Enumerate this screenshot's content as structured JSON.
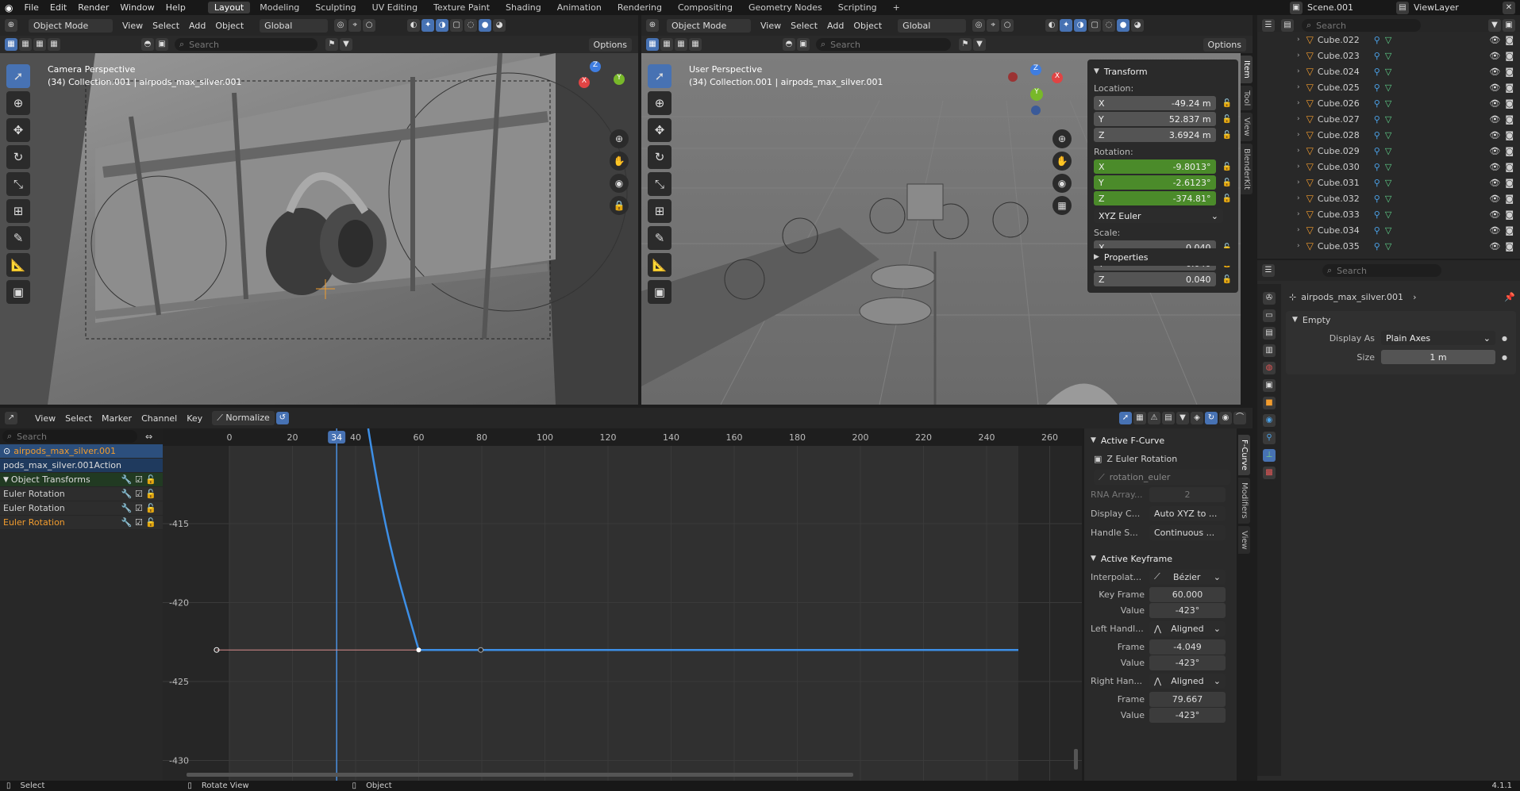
{
  "topbar": {
    "menus": [
      "File",
      "Edit",
      "Render",
      "Window",
      "Help"
    ],
    "workspaces": [
      "Layout",
      "Modeling",
      "Sculpting",
      "UV Editing",
      "Texture Paint",
      "Shading",
      "Animation",
      "Rendering",
      "Compositing",
      "Geometry Nodes",
      "Scripting"
    ],
    "active_workspace": "Layout",
    "plus": "+",
    "scene": "Scene.001",
    "view_layer": "ViewLayer"
  },
  "vp_left": {
    "mode": "Object Mode",
    "menus": [
      "View",
      "Select",
      "Add",
      "Object"
    ],
    "orientation": "Global",
    "search_placeholder": "Search",
    "options": "Options",
    "title": "Camera Perspective",
    "subtitle": "(34) Collection.001 | airpods_max_silver.001"
  },
  "vp_right": {
    "mode": "Object Mode",
    "menus": [
      "View",
      "Select",
      "Add",
      "Object"
    ],
    "orientation": "Global",
    "search_placeholder": "Search",
    "options": "Options",
    "title": "User Perspective",
    "subtitle": "(34) Collection.001 | airpods_max_silver.001",
    "gizmo": {
      "z": "Z",
      "y": "Y",
      "x": "X"
    }
  },
  "npanel": {
    "tabs": [
      "Item",
      "Tool",
      "View",
      "BlenderKit"
    ],
    "transform": "Transform",
    "location_label": "Location:",
    "location": [
      {
        "axis": "X",
        "value": "-49.24 m"
      },
      {
        "axis": "Y",
        "value": "52.837 m"
      },
      {
        "axis": "Z",
        "value": "3.6924 m"
      }
    ],
    "rotation_label": "Rotation:",
    "rotation": [
      {
        "axis": "X",
        "value": "-9.8013°"
      },
      {
        "axis": "Y",
        "value": "-2.6123°"
      },
      {
        "axis": "Z",
        "value": "-374.81°"
      }
    ],
    "rotation_mode": "XYZ Euler",
    "scale_label": "Scale:",
    "scale": [
      {
        "axis": "X",
        "value": "0.040"
      },
      {
        "axis": "Y",
        "value": "0.040"
      },
      {
        "axis": "Z",
        "value": "0.040"
      }
    ],
    "properties": "Properties"
  },
  "outliner": {
    "search_placeholder": "Search",
    "items": [
      "Cube.022",
      "Cube.023",
      "Cube.024",
      "Cube.025",
      "Cube.026",
      "Cube.027",
      "Cube.028",
      "Cube.029",
      "Cube.030",
      "Cube.031",
      "Cube.032",
      "Cube.033",
      "Cube.034",
      "Cube.035"
    ]
  },
  "properties": {
    "search_placeholder": "Search",
    "object_name": "airpods_max_silver.001",
    "section": "Empty",
    "display_as_label": "Display As",
    "display_as_value": "Plain Axes",
    "size_label": "Size",
    "size_value": "1 m"
  },
  "graph": {
    "menus": [
      "View",
      "Select",
      "Marker",
      "Channel",
      "Key"
    ],
    "normalize": "Normalize",
    "search_placeholder": "Search",
    "frame_ticks": [
      "0",
      "20",
      "40",
      "60",
      "80",
      "100",
      "120",
      "140",
      "160",
      "180",
      "200",
      "220",
      "240",
      "260"
    ],
    "current_frame": "34",
    "value_ticks": [
      "-415",
      "-420",
      "-425",
      "-430"
    ],
    "channels": [
      "airpods_max_silver.001",
      "pods_max_silver.001Action",
      "Object Transforms",
      "Euler Rotation",
      "Euler Rotation",
      "Euler Rotation"
    ],
    "curve_color": "#3d8fe6"
  },
  "graph_side": {
    "tabs": [
      "F-Curve",
      "Modifiers",
      "View"
    ],
    "active_fcurve": "Active F-Curve",
    "fcurve_name": "Z Euler Rotation",
    "rna_path": "rotation_euler",
    "rna_array_label": "RNA Array...",
    "rna_array_value": "2",
    "display_color_label": "Display C...",
    "display_color_value": "Auto XYZ to ...",
    "handle_smoothing_label": "Handle S...",
    "handle_smoothing_value": "Continuous ...",
    "active_keyframe": "Active Keyframe",
    "interp_label": "Interpolat...",
    "interp_value": "Bézier",
    "keyframe_label": "Key Frame",
    "keyframe_value": "60.000",
    "value_label": "Value",
    "value_value": "-423°",
    "left_handle_label": "Left Handl...",
    "left_handle_type": "Aligned",
    "lh_frame_label": "Frame",
    "lh_frame_value": "-4.049",
    "lh_value_label": "Value",
    "lh_value_value": "-423°",
    "right_handle_label": "Right Han...",
    "right_handle_type": "Aligned",
    "rh_frame_label": "Frame",
    "rh_frame_value": "79.667",
    "rh_value_label": "Value",
    "rh_value_value": "-423°"
  },
  "status": {
    "select": "Select",
    "rotate_view": "Rotate View",
    "object": "Object",
    "version": "4.1.1"
  }
}
